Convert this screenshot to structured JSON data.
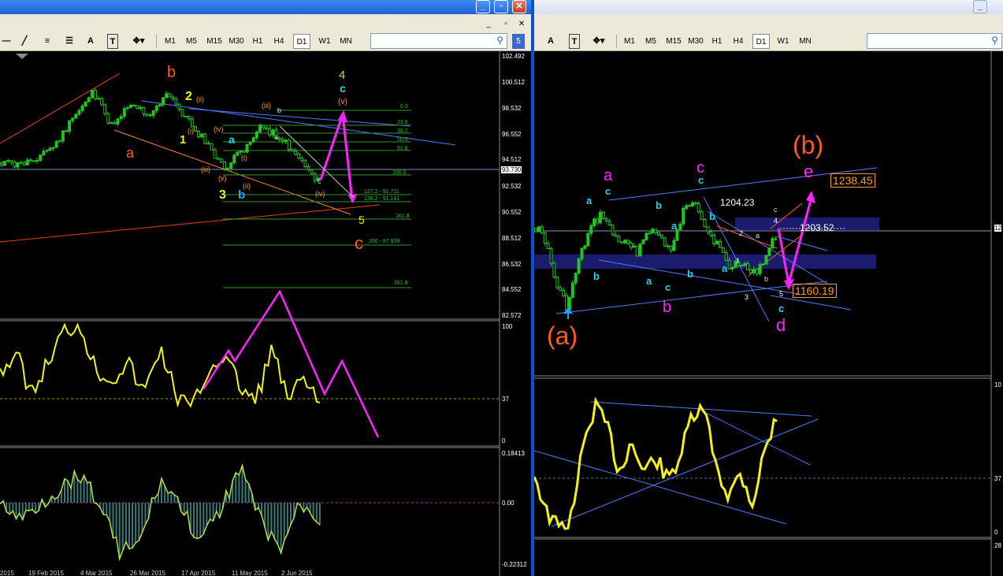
{
  "left_window": {
    "titlebar_buttons": [
      "_",
      "▫",
      "✕"
    ],
    "mdi_buttons": [
      "_",
      "▫",
      "✕"
    ],
    "timeframes": [
      "M1",
      "M5",
      "M15",
      "M30",
      "H1",
      "H4",
      "D1",
      "W1",
      "MN"
    ],
    "active_timeframe": "D1",
    "tools": [
      "A",
      "T"
    ],
    "badge": "5",
    "price_axis": [
      "102.492",
      "100.512",
      "98.532",
      "96.552",
      "94.512",
      "92.532",
      "90.552",
      "88.512",
      "86.532",
      "84.552",
      "82.572"
    ],
    "current_price": "93.730",
    "fib_labels": [
      "0.0",
      "23.6",
      "38.2",
      "50.0",
      "61.8",
      "100.0",
      "127.2 - 91.711",
      "138.2 - 91.141",
      "161.8",
      "200 - 87.939",
      "261.8"
    ],
    "rsi_axis": [
      "100",
      "37",
      "0"
    ],
    "macd_axis": [
      "0.18413",
      "0.00",
      "-0.22312"
    ],
    "date_axis": [
      "2015",
      "19 Feb 2015",
      "4 Mar 2015",
      "26 Mar 2015",
      "17 Apr 2015",
      "11 May 2015",
      "2 Jun 2015"
    ],
    "wave_labels": {
      "a_orange": "a",
      "b_orange": "b",
      "c_orange": "c",
      "w1": "1",
      "w2": "2",
      "w3": "3",
      "w4": "4",
      "w5": "5",
      "a_cyan": "a",
      "b_cyan": "b",
      "c_cyan": "c",
      "i": "(i)",
      "ii": "(ii)",
      "iii": "(iii)",
      "iv": "(iv)",
      "v": "(v)",
      "i2": "(i)",
      "ii2": "(ii)",
      "iii2": "(iii)",
      "iv2": "(iv)",
      "v2": "(v)",
      "sa": "a",
      "sb": "b",
      "sc": "c"
    }
  },
  "right_window": {
    "titlebar_buttons": [
      "_"
    ],
    "timeframes": [
      "M1",
      "M5",
      "M15",
      "M30",
      "H1",
      "H4",
      "D1",
      "W1",
      "MN"
    ],
    "active_timeframe": "D1",
    "tools": [
      "A",
      "T"
    ],
    "rsi_axis": [
      "10",
      "37",
      "0"
    ],
    "price_right_tags": [
      "12"
    ],
    "bottom_axis_label": "28",
    "annotations": {
      "big_a": "(a)",
      "big_b": "(b)",
      "m_a": "a",
      "m_c": "c",
      "m_b": "b",
      "m_d": "d",
      "m_e": "e",
      "price_1204": "1204.23",
      "price_1203": "1203.52",
      "price_1238": "1238.45",
      "price_1160": "1160.19",
      "cy_a1": "a",
      "cy_c1": "c",
      "cy_b1": "b",
      "cy_b2": "b",
      "cy_a2": "a",
      "cy_c2": "c",
      "cy_b3": "b",
      "cy_c3": "c",
      "cy_b4": "b",
      "cy_a3": "a",
      "cy_c4": "c",
      "w_2": "2",
      "w_1": "1",
      "w_3": "3",
      "w_4": "4",
      "w_5": "5",
      "w_a": "a",
      "w_b": "b",
      "w_c": "c"
    }
  },
  "colors": {
    "titlebar": "#2a6ae0",
    "toolbar": "#ece9d8",
    "candles": "#22c422",
    "rsi_line": "#f2f21a",
    "magenta": "#ff22ff",
    "trend_blue": "#4f7cff",
    "orange": "#ff5a1f",
    "fib_green": "#3cb43c",
    "zone": "#1c1c6e"
  }
}
